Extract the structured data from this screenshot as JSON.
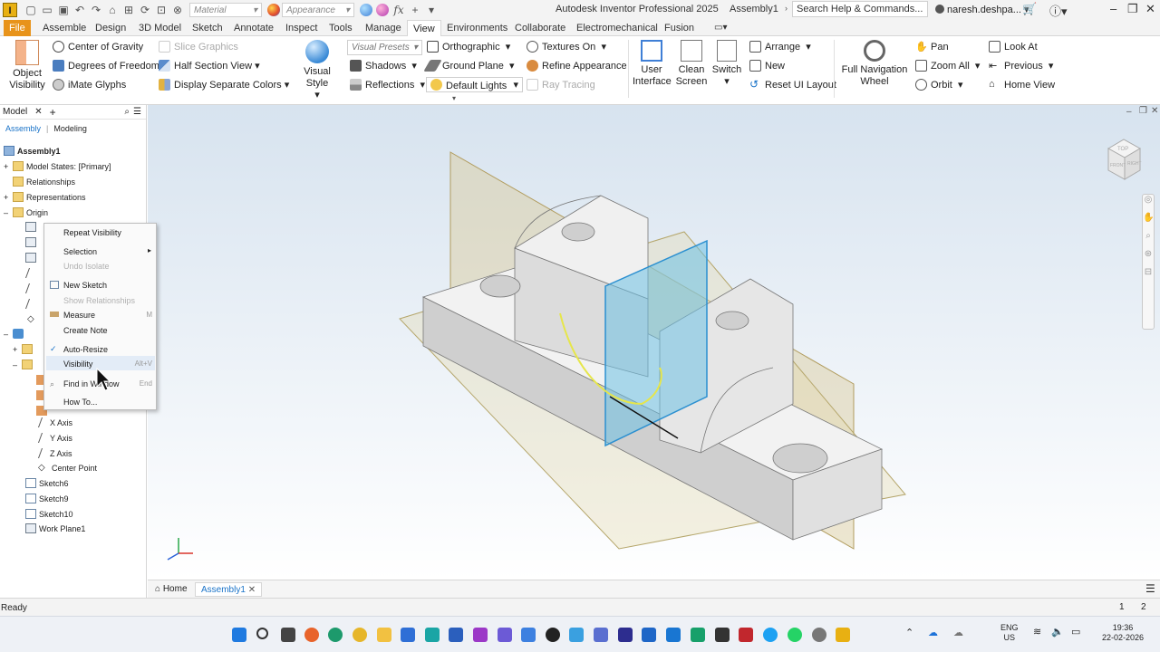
{
  "titlebar": {
    "app_letter": "I",
    "material_placeholder": "Material",
    "appearance_placeholder": "Appearance",
    "fx": "fx",
    "app_title": "Autodesk Inventor Professional 2025",
    "doc_title": "Assembly1",
    "search_placeholder": "Search Help & Commands...",
    "user": "naresh.deshpa..."
  },
  "tabs": [
    {
      "label": "File"
    },
    {
      "label": "Assemble"
    },
    {
      "label": "Design"
    },
    {
      "label": "3D Model"
    },
    {
      "label": "Sketch"
    },
    {
      "label": "Annotate"
    },
    {
      "label": "Inspect"
    },
    {
      "label": "Tools"
    },
    {
      "label": "Manage"
    },
    {
      "label": "View"
    },
    {
      "label": "Environments"
    },
    {
      "label": "Collaborate"
    },
    {
      "label": "Electromechanical"
    },
    {
      "label": "Fusion"
    }
  ],
  "ribbon": {
    "object_visibility": "Object Visibility",
    "center_of_gravity": "Center of Gravity",
    "degrees_of_freedom": "Degrees of Freedom",
    "imate_glyphs": "iMate Glyphs",
    "slice_graphics": "Slice Graphics",
    "half_section_view": "Half Section View",
    "display_separate_colors": "Display Separate Colors",
    "visual_style": "Visual Style",
    "visual_presets": "Visual Presets",
    "shadows": "Shadows",
    "reflections": "Reflections",
    "orthographic": "Orthographic",
    "ground_plane": "Ground Plane",
    "default_lights": "Default Lights",
    "textures_on": "Textures On",
    "refine_appearance": "Refine Appearance",
    "ray_tracing": "Ray Tracing",
    "user_interface": "User Interface",
    "clean_screen": "Clean Screen",
    "switch": "Switch",
    "arrange": "Arrange",
    "new": "New",
    "reset_ui_layout": "Reset UI Layout",
    "full_navigation_wheel": "Full Navigation Wheel",
    "pan": "Pan",
    "zoom_all": "Zoom All",
    "orbit": "Orbit",
    "look_at": "Look At",
    "previous": "Previous",
    "home_view": "Home View"
  },
  "browser": {
    "title": "Model",
    "tab_assembly": "Assembly",
    "tab_modeling": "Modeling",
    "nodes": [
      "Assembly1",
      "Model States: [Primary]",
      "Relationships",
      "Representations",
      "Origin",
      "X Axis",
      "Y Axis",
      "Z Axis",
      "Center Point",
      "Sketch6",
      "Sketch9",
      "Sketch10",
      "Work Plane1"
    ]
  },
  "context_menu": {
    "items": [
      {
        "label": "Repeat Visibility",
        "shortcut": ""
      },
      {
        "label": "Selection",
        "shortcut": ""
      },
      {
        "label": "Undo Isolate",
        "shortcut": ""
      },
      {
        "label": "New Sketch",
        "shortcut": ""
      },
      {
        "label": "Show Relationships",
        "shortcut": ""
      },
      {
        "label": "Measure",
        "shortcut": "M"
      },
      {
        "label": "Create Note",
        "shortcut": ""
      },
      {
        "label": "Auto-Resize",
        "shortcut": ""
      },
      {
        "label": "Visibility",
        "shortcut": "Alt+V"
      },
      {
        "label": "Find in Window",
        "shortcut": "End"
      },
      {
        "label": "How To...",
        "shortcut": ""
      }
    ]
  },
  "viewcube": {
    "top": "TOP",
    "front": "FRONT",
    "right": "RIGHT"
  },
  "doc_tabs": {
    "home": "Home",
    "assembly": "Assembly1"
  },
  "status": {
    "text": "Ready",
    "n1": "1",
    "n2": "2"
  },
  "tray": {
    "lang1": "ENG",
    "lang2": "US",
    "time": "19:36",
    "date": "22-02-2026"
  },
  "colors": {
    "file_tab": "#e8931a",
    "accent_blue": "#1a73c8",
    "workplane": "#6ec1e4"
  }
}
